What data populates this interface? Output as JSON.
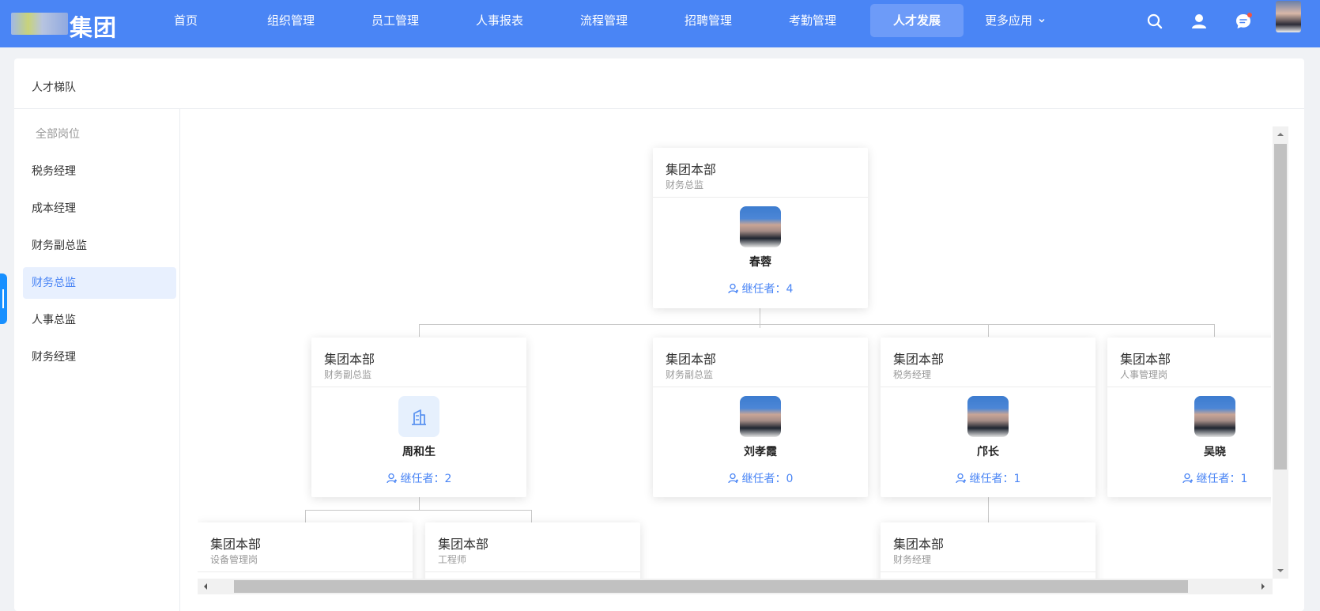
{
  "header": {
    "logo_text": "集团",
    "nav": [
      {
        "label": "首页"
      },
      {
        "label": "组织管理"
      },
      {
        "label": "员工管理"
      },
      {
        "label": "人事报表"
      },
      {
        "label": "流程管理"
      },
      {
        "label": "招聘管理"
      },
      {
        "label": "考勤管理"
      },
      {
        "label": "人才发展",
        "active": true
      },
      {
        "label": "更多应用"
      }
    ],
    "icons": [
      "search-icon",
      "user-icon",
      "message-icon",
      "avatar"
    ],
    "accent_color": "#4a85f5"
  },
  "page": {
    "title": "人才梯队"
  },
  "sidebar": {
    "items": [
      {
        "label": "全部岗位"
      },
      {
        "label": "税务经理"
      },
      {
        "label": "成本经理"
      },
      {
        "label": "财务副总监"
      },
      {
        "label": "财务总监",
        "active": true
      },
      {
        "label": "人事总监"
      },
      {
        "label": "财务经理"
      }
    ]
  },
  "org_chart": {
    "succ_label_prefix": "继任者：",
    "root": {
      "dept": "集团本部",
      "post": "财务总监",
      "name": "春蓉",
      "succ": "继任者：4",
      "avatar": "photo"
    },
    "level2": [
      {
        "dept": "集团本部",
        "post": "财务副总监",
        "name": "周和生",
        "succ": "继任者：2",
        "avatar": "building-icon"
      },
      {
        "dept": "集团本部",
        "post": "财务副总监",
        "name": "刘孝霞",
        "succ": "继任者：0",
        "avatar": "photo"
      },
      {
        "dept": "集团本部",
        "post": "税务经理",
        "name": "邝长",
        "succ": "继任者：1",
        "avatar": "photo"
      },
      {
        "dept": "集团本部",
        "post": "人事管理岗",
        "name": "吴晓",
        "succ": "继任者：1",
        "avatar": "photo"
      }
    ],
    "level3": [
      {
        "dept": "集团本部",
        "post": "设备管理岗"
      },
      {
        "dept": "集团本部",
        "post": "工程师"
      },
      {
        "dept": "集团本部",
        "post": "财务经理"
      }
    ]
  }
}
